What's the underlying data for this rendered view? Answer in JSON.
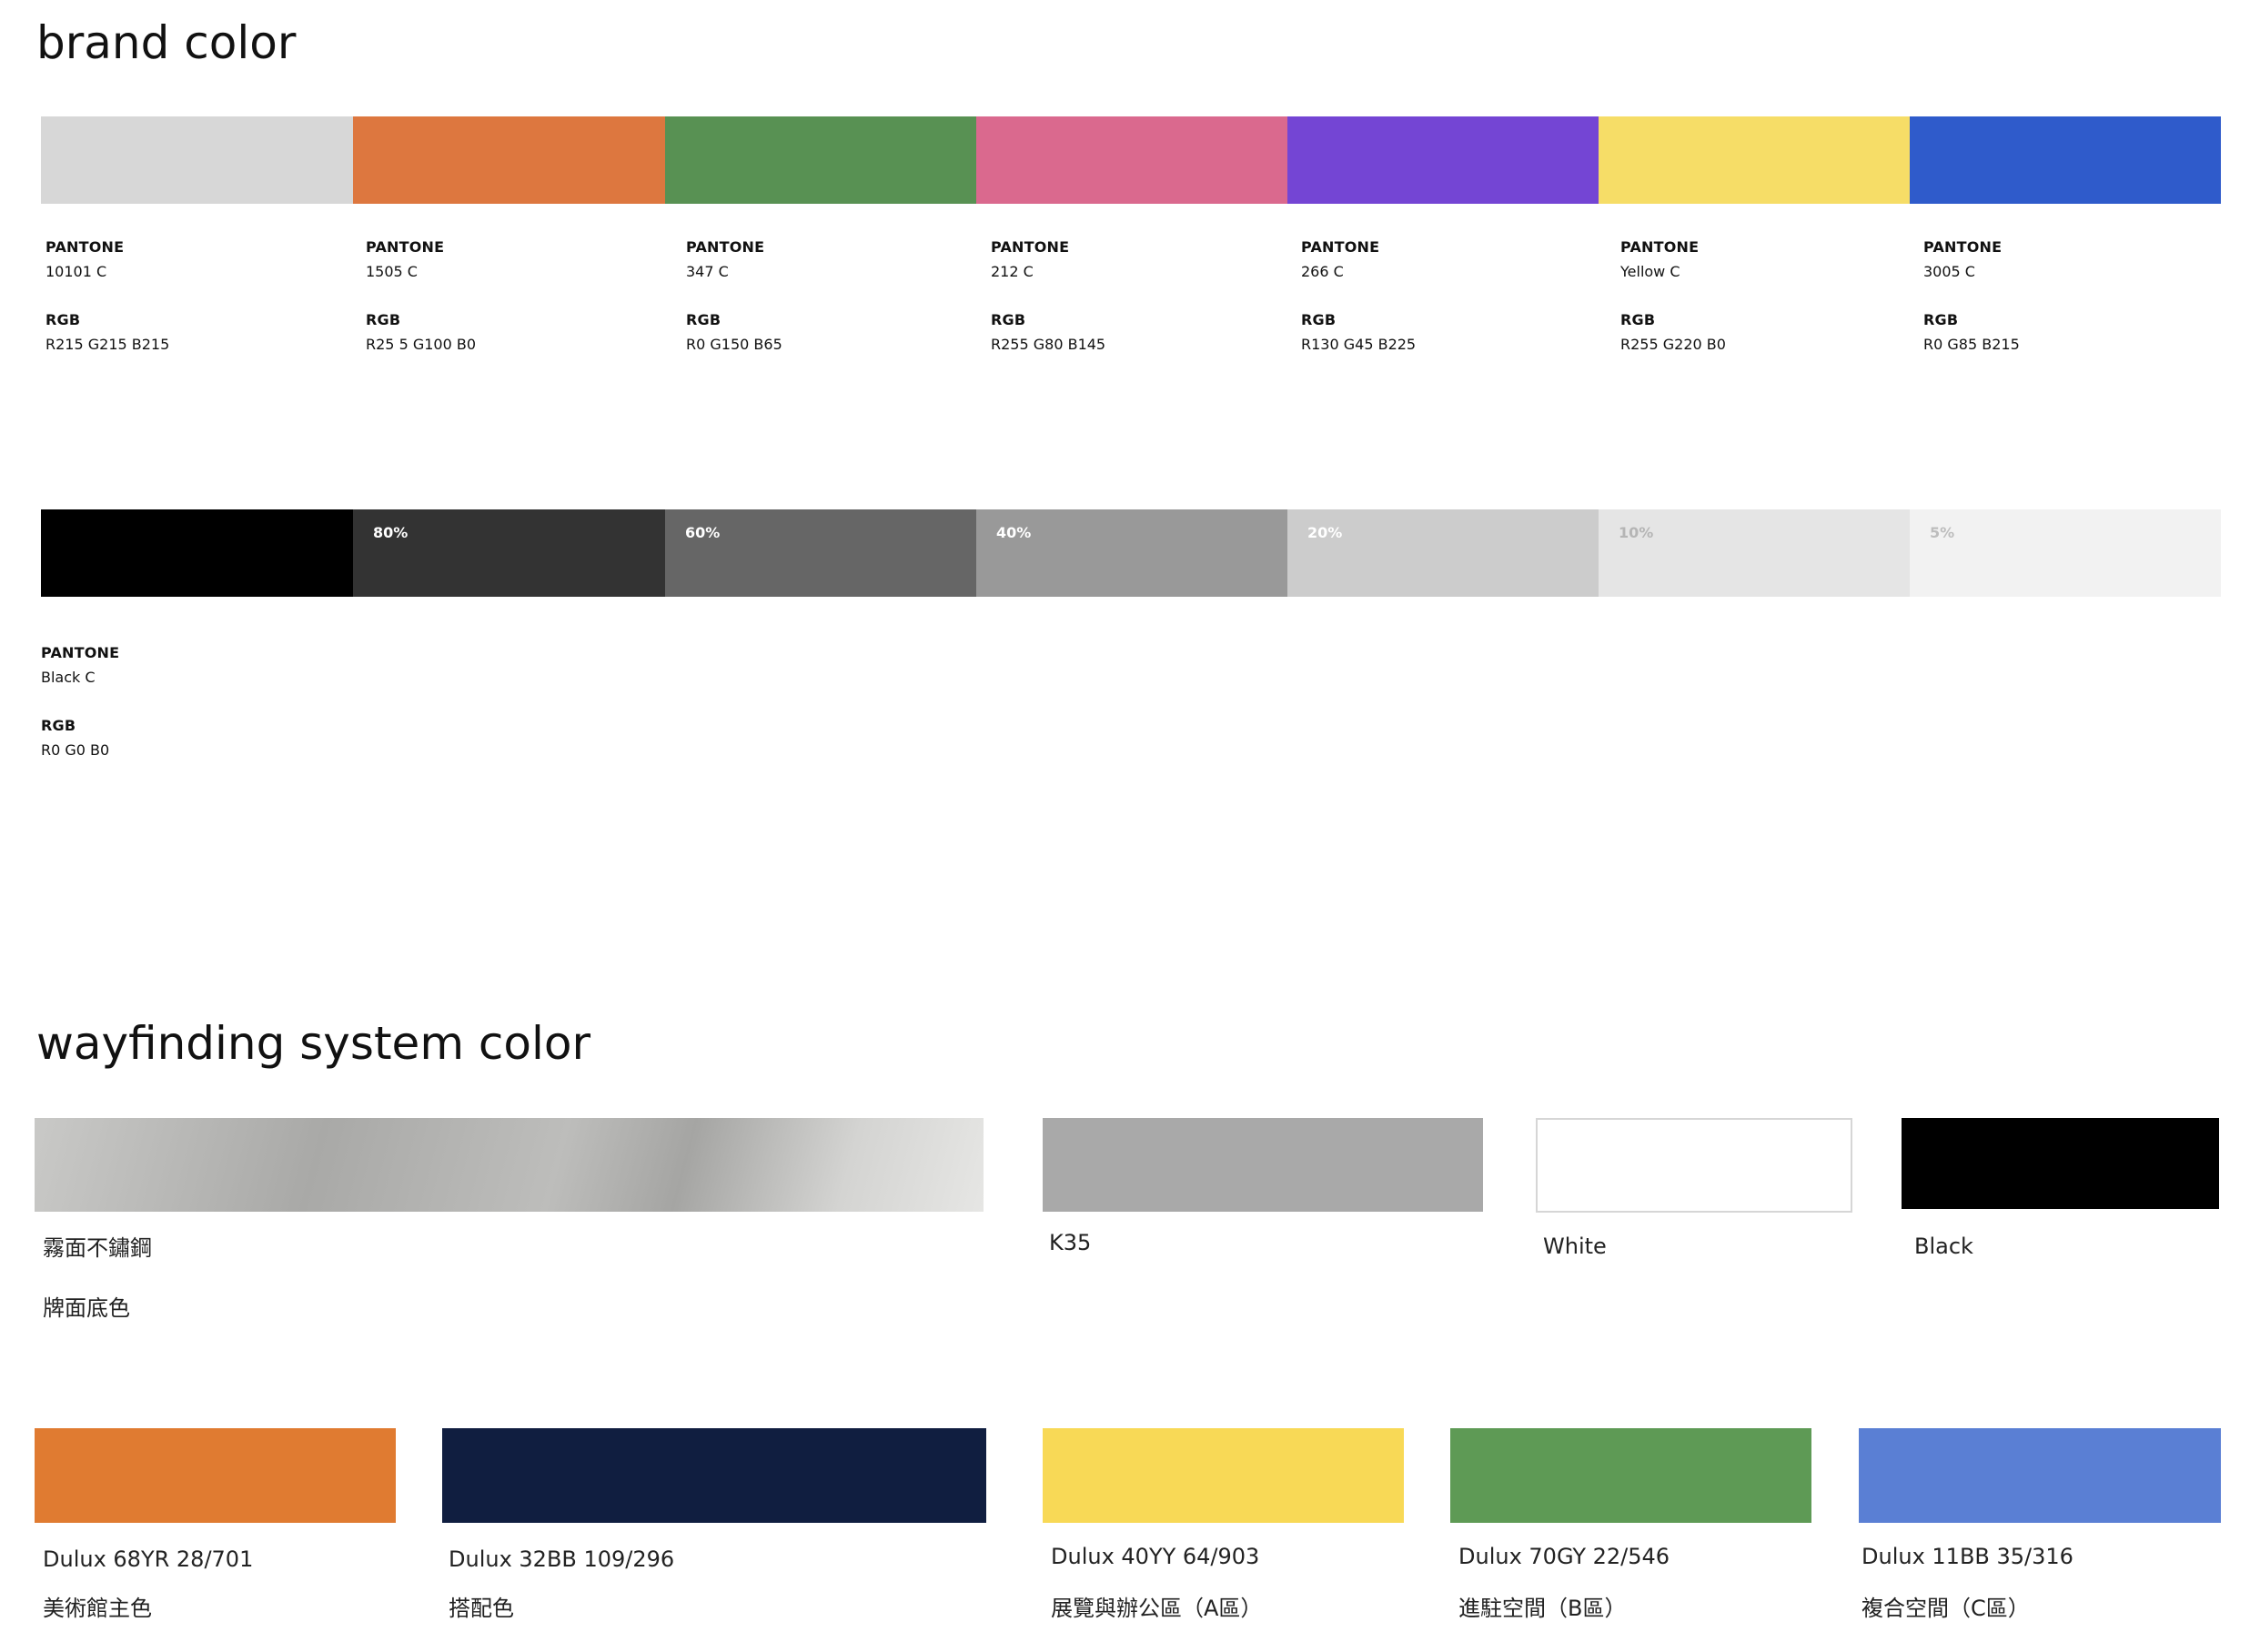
{
  "brand": {
    "title": "brand color",
    "colors": [
      {
        "hex": "#d7d7d7",
        "pantone_label": "PANTONE",
        "pantone": "10101 C",
        "rgb_label": "RGB",
        "rgb": "R215  G215  B215"
      },
      {
        "hex": "#dd773f",
        "pantone_label": "PANTONE",
        "pantone": "1505 C",
        "rgb_label": "RGB",
        "rgb": "R25 5 G100  B0"
      },
      {
        "hex": "#589153",
        "pantone_label": "PANTONE",
        "pantone": "347 C",
        "rgb_label": "RGB",
        "rgb": "R0  G150  B65"
      },
      {
        "hex": "#da698e",
        "pantone_label": "PANTONE",
        "pantone": "212 C",
        "rgb_label": "RGB",
        "rgb": "R255  G80  B145"
      },
      {
        "hex": "#7445d4",
        "pantone_label": "PANTONE",
        "pantone": "266 C",
        "rgb_label": "RGB",
        "rgb": "R130  G45  B225"
      },
      {
        "hex": "#f6dd67",
        "pantone_label": "PANTONE",
        "pantone": "Yellow C",
        "rgb_label": "RGB",
        "rgb": "R255  G220  B0"
      },
      {
        "hex": "#2f5bcb",
        "pantone_label": "PANTONE",
        "pantone": "3005 C",
        "rgb_label": "RGB",
        "rgb": "R0  G85  B215"
      }
    ],
    "tints": [
      {
        "hex": "#000000",
        "label": "",
        "text_color": "#ffffff"
      },
      {
        "hex": "#333333",
        "label": "80%",
        "text_color": "#ffffff"
      },
      {
        "hex": "#666666",
        "label": "60%",
        "text_color": "#ffffff"
      },
      {
        "hex": "#999999",
        "label": "40%",
        "text_color": "#ffffff"
      },
      {
        "hex": "#cccccc",
        "label": "20%",
        "text_color": "#ffffff"
      },
      {
        "hex": "#e5e5e5",
        "label": "10%",
        "text_color": "#b5b5b5"
      },
      {
        "hex": "#f2f2f2",
        "label": "5%",
        "text_color": "#bdbdbd"
      }
    ],
    "black": {
      "pantone_label": "PANTONE",
      "pantone": "Black C",
      "rgb_label": "RGB",
      "rgb": "R0  G0  B0"
    }
  },
  "wayfinding": {
    "title": "wayfinding system color",
    "row1": [
      {
        "name": "霧面不鏽鋼",
        "sub": "牌面底色",
        "hex": "#b8b8b6",
        "style": "gradient"
      },
      {
        "name": "K35",
        "sub": "",
        "hex": "#a9a9a9",
        "style": "solid"
      },
      {
        "name": "White",
        "sub": "",
        "hex": "#ffffff",
        "style": "outlined"
      },
      {
        "name": "Black",
        "sub": "",
        "hex": "#000000",
        "style": "solid"
      }
    ],
    "row2": [
      {
        "name": "Dulux 68YR 28/701",
        "sub": "美術館主色",
        "hex": "#e07b31"
      },
      {
        "name": "Dulux 32BB 109/296",
        "sub": "搭配色",
        "hex": "#101e40"
      },
      {
        "name": "Dulux 40YY 64/903",
        "sub": "展覽與辦公區（A區）",
        "hex": "#f8d956"
      },
      {
        "name": "Dulux 70GY 22/546",
        "sub": "進駐空間（B區）",
        "hex": "#5e9a55"
      },
      {
        "name": "Dulux 11BB 35/316",
        "sub": "複合空間（C區）",
        "hex": "#5a7fd4"
      }
    ]
  }
}
